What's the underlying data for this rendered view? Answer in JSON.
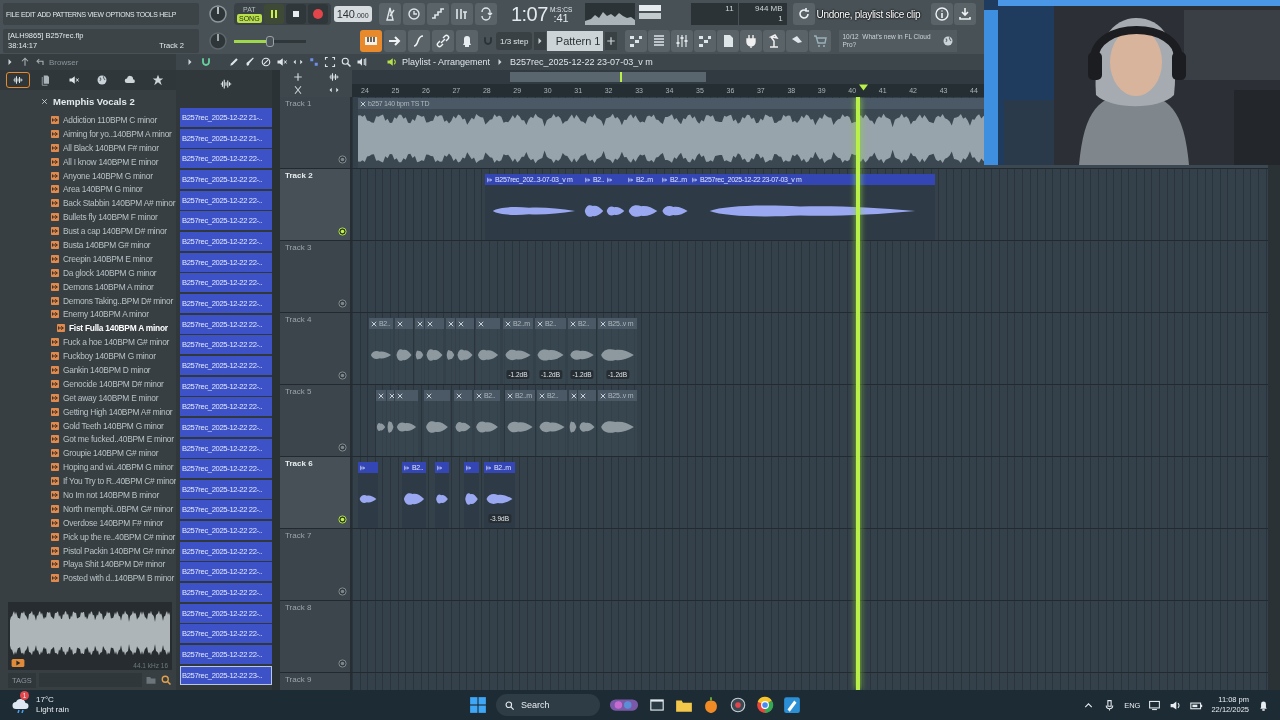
{
  "menu": [
    "FILE",
    "EDIT",
    "ADD",
    "PATTERNS",
    "VIEW",
    "OPTIONS",
    "TOOLS",
    "HELP"
  ],
  "transport": {
    "modes": [
      {
        "label": "PAT",
        "selected": false
      },
      {
        "label": "SONG",
        "selected": true
      }
    ],
    "playing": true
  },
  "tempo": {
    "value": "140",
    "decimals": ".000"
  },
  "time": {
    "main": "1:07",
    "sub": ":41",
    "unit": "M:S:CS"
  },
  "monitor": {
    "cpu": "11",
    "memory": "944 MB",
    "polyphony": "1"
  },
  "hint": "Undone, playlist slice clip",
  "project": {
    "file": "[ALH9865] B257rec.flp",
    "elapsed": "38:14:17",
    "focus": "Track 2"
  },
  "master_volume": {
    "level": 0.5
  },
  "snap": "1/3 step",
  "pattern": "Pattern 1",
  "news": {
    "counter": "10/12",
    "text": "What's new in FL Cloud Pro?"
  },
  "browser": {
    "title": "Browser",
    "folder": "Memphis Vocals 2",
    "items": [
      {
        "label": "Addiction 110BPM C minor",
        "selected": false
      },
      {
        "label": "Aiming for yo..140BPM A minor",
        "selected": false
      },
      {
        "label": "All Black 140BPM F# minor",
        "selected": false
      },
      {
        "label": "All I know 140BPM E minor",
        "selected": false
      },
      {
        "label": "Anyone 140BPM G minor",
        "selected": false
      },
      {
        "label": "Area 140BPM G minor",
        "selected": false
      },
      {
        "label": "Back Stabbin 140BPM A# minor",
        "selected": false
      },
      {
        "label": "Bullets fly 140BPM F minor",
        "selected": false
      },
      {
        "label": "Bust a cap 140BPM D# minor",
        "selected": false
      },
      {
        "label": "Busta 140BPM G# minor",
        "selected": false
      },
      {
        "label": "Creepin 140BPM E minor",
        "selected": false
      },
      {
        "label": "Da glock 140BPM G minor",
        "selected": false
      },
      {
        "label": "Demons 140BPM A minor",
        "selected": false
      },
      {
        "label": "Demons Taking..BPM D# minor",
        "selected": false
      },
      {
        "label": "Enemy 140BPM A minor",
        "selected": false
      },
      {
        "label": "Fist Fulla 140BPM A minor",
        "selected": true
      },
      {
        "label": "Fuck a hoe 140BPM G# minor",
        "selected": false
      },
      {
        "label": "Fuckboy 140BPM G minor",
        "selected": false
      },
      {
        "label": "Gankin 140BPM D minor",
        "selected": false
      },
      {
        "label": "Genocide 140BPM D# minor",
        "selected": false
      },
      {
        "label": "Get away 140BPM E minor",
        "selected": false
      },
      {
        "label": "Getting High 140BPM A# minor",
        "selected": false
      },
      {
        "label": "Gold Teeth 140BPM G minor",
        "selected": false
      },
      {
        "label": "Got me fucked..40BPM E minor",
        "selected": false
      },
      {
        "label": "Groupie 140BPM G# minor",
        "selected": false
      },
      {
        "label": "Hoping and wi..40BPM G minor",
        "selected": false
      },
      {
        "label": "If You Try to R..40BPM C# minor",
        "selected": false
      },
      {
        "label": "No Im not 140BPM B minor",
        "selected": false
      },
      {
        "label": "North memphi..0BPM G# minor",
        "selected": false
      },
      {
        "label": "Overdose 140BPM F# minor",
        "selected": false
      },
      {
        "label": "Pick up the re..40BPM C# minor",
        "selected": false
      },
      {
        "label": "Pistol Packin 140BPM G# minor",
        "selected": false
      },
      {
        "label": "Playa Shit 140BPM D# minor",
        "selected": false
      },
      {
        "label": "Posted with d..140BPM B minor",
        "selected": false
      }
    ],
    "preview": {
      "info": "44.1 kHz 16"
    },
    "tags": "TAGS"
  },
  "clip_list": [
    {
      "label": "B257rec_2025-12-22 21-..",
      "selected": false
    },
    {
      "label": "B257rec_2025-12-22 21-..",
      "selected": false
    },
    {
      "label": "B257rec_2025-12-22 22-..",
      "selected": false
    },
    {
      "label": "B257rec_2025-12-22 22-..",
      "selected": false
    },
    {
      "label": "B257rec_2025-12-22 22-..",
      "selected": false
    },
    {
      "label": "B257rec_2025-12-22 22-..",
      "selected": false
    },
    {
      "label": "B257rec_2025-12-22 22-..",
      "selected": false
    },
    {
      "label": "B257rec_2025-12-22 22-..",
      "selected": false
    },
    {
      "label": "B257rec_2025-12-22 22-..",
      "selected": false
    },
    {
      "label": "B257rec_2025-12-22 22-..",
      "selected": false
    },
    {
      "label": "B257rec_2025-12-22 22-..",
      "selected": false
    },
    {
      "label": "B257rec_2025-12-22 22-..",
      "selected": false
    },
    {
      "label": "B257rec_2025-12-22 22-..",
      "selected": false
    },
    {
      "label": "B257rec_2025-12-22 22-..",
      "selected": false
    },
    {
      "label": "B257rec_2025-12-22 22-..",
      "selected": false
    },
    {
      "label": "B257rec_2025-12-22 22-..",
      "selected": false
    },
    {
      "label": "B257rec_2025-12-22 22-..",
      "selected": false
    },
    {
      "label": "B257rec_2025-12-22 22-..",
      "selected": false
    },
    {
      "label": "B257rec_2025-12-22 22-..",
      "selected": false
    },
    {
      "label": "B257rec_2025-12-22 22-..",
      "selected": false
    },
    {
      "label": "B257rec_2025-12-22 22-..",
      "selected": false
    },
    {
      "label": "B257rec_2025-12-22 22-..",
      "selected": false
    },
    {
      "label": "B257rec_2025-12-22 22-..",
      "selected": false
    },
    {
      "label": "B257rec_2025-12-22 22-..",
      "selected": false
    },
    {
      "label": "B257rec_2025-12-22 22-..",
      "selected": false
    },
    {
      "label": "B257rec_2025-12-22 22-..",
      "selected": false
    },
    {
      "label": "B257rec_2025-12-22 22-..",
      "selected": false
    },
    {
      "label": "B257rec_2025-12-22 23-..",
      "selected": true
    }
  ],
  "playlist": {
    "title": "Playlist - Arrangement",
    "clip": "B257rec_2025-12-22 23-07-03_v m",
    "bars": [
      "24",
      "25",
      "26",
      "27",
      "28",
      "29",
      "30",
      "31",
      "32",
      "33",
      "34",
      "35",
      "36",
      "37",
      "38",
      "39",
      "40",
      "41",
      "42",
      "43",
      "44"
    ],
    "tracks": [
      {
        "name": "Track 1",
        "active": false,
        "clips": [
          {
            "muted": true,
            "label": "b257 140 bpm TS TD"
          }
        ]
      },
      {
        "name": "Track 2",
        "active": true,
        "clips": [
          {
            "muted": false,
            "label": "B257rec_202..3-07-03_v m"
          },
          {
            "muted": false,
            "label": "B2.."
          },
          {
            "muted": false
          },
          {
            "muted": false,
            "label": "B2..m"
          },
          {
            "muted": false,
            "label": "B2..m"
          },
          {
            "muted": false,
            "label": "B257rec_2025-12-22 23-07-03_v m"
          }
        ]
      },
      {
        "name": "Track 3",
        "active": false
      },
      {
        "name": "Track 4",
        "active": false,
        "clips": [
          {
            "muted": true,
            "label": "B2.."
          },
          {
            "muted": true
          },
          {
            "muted": true
          },
          {
            "muted": true
          },
          {
            "muted": true
          },
          {
            "muted": true
          },
          {
            "muted": true
          },
          {
            "muted": true,
            "label": "B2..m",
            "gain": "-1.2dB"
          },
          {
            "muted": true,
            "label": "B2..",
            "gain": "-1.2dB"
          },
          {
            "muted": true,
            "label": "B2..",
            "gain": "-1.2dB"
          },
          {
            "muted": true,
            "label": "B25..v m",
            "gain": "-1.2dB"
          }
        ]
      },
      {
        "name": "Track 5",
        "active": false,
        "clips": [
          {
            "muted": true
          },
          {
            "muted": true
          },
          {
            "muted": true
          },
          {
            "muted": true
          },
          {
            "muted": true
          },
          {
            "muted": true,
            "label": "B2.."
          },
          {
            "muted": true,
            "label": "B2..m"
          },
          {
            "muted": true,
            "label": "B2.."
          },
          {
            "muted": true
          },
          {
            "muted": true
          },
          {
            "muted": true,
            "label": "B25..v m"
          }
        ]
      },
      {
        "name": "Track 6",
        "active": true,
        "clips": [
          {
            "muted": false
          },
          {
            "muted": false,
            "label": "B2.."
          },
          {
            "muted": false
          },
          {
            "muted": false
          },
          {
            "muted": false,
            "label": "B2..m",
            "gain": "-3.9dB"
          }
        ]
      },
      {
        "name": "Track 7",
        "active": false
      },
      {
        "name": "Track 8",
        "active": false
      },
      {
        "name": "Track 9",
        "active": false
      }
    ]
  },
  "taskbar": {
    "temperature": "17°C",
    "weather": "Light rain",
    "badge": "1",
    "search": {
      "placeholder": "Search"
    },
    "language": "ENG",
    "time": "11:08 pm",
    "date": "22/12/2025"
  }
}
